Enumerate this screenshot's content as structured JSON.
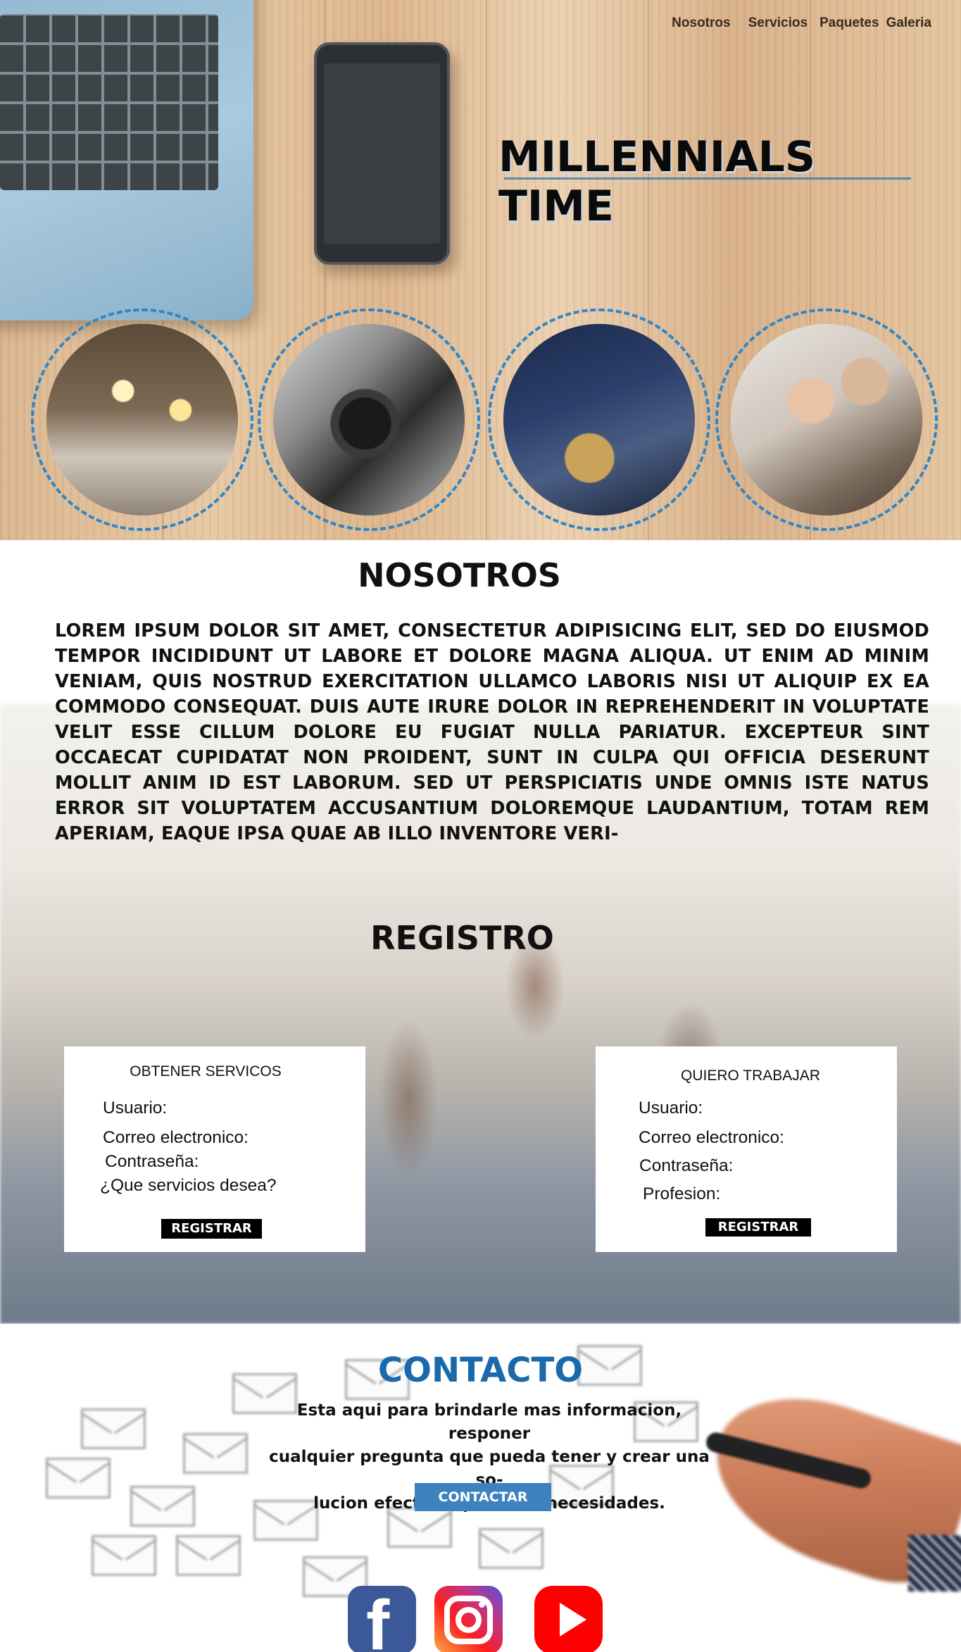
{
  "nav": {
    "items": [
      "Nosotros",
      "Servicios",
      "Paquetes",
      "Galeria"
    ]
  },
  "hero": {
    "title": "MILLENNIALS TIME"
  },
  "gallery": [
    {
      "icon": "event-lights-icon"
    },
    {
      "icon": "video-camera-icon"
    },
    {
      "icon": "dj-turntable-icon"
    },
    {
      "icon": "makeup-artist-icon"
    }
  ],
  "nosotros": {
    "title": "NOSOTROS",
    "text": "Lorem ipsum dolor sit amet, consectetur adipisicing elit, sed do eiusmod tempor incididunt ut labore et dolore magna aliqua. Ut enim ad minim veniam, quis nostrud exercitation ullamco laboris nisi ut aliquip ex ea commodo consequat. Duis aute irure dolor in reprehenderit in voluptate velit esse cillum dolore eu fugiat nulla pariatur. Excepteur sint occaecat cupidatat non proident, sunt in culpa qui officia deserunt mollit anim id est laborum. Sed ut perspiciatis unde omnis iste natus error sit voluptatem accusantium doloremque laudantium, totam rem aperiam, eaque ipsa quae ab illo inventore veri-"
  },
  "registro": {
    "title": "REGISTRO",
    "servicios": {
      "title": "OBTENER SERVICOS",
      "usuario": "Usuario:",
      "correo": "Correo electronico:",
      "password": "Contraseña:",
      "servicios": "¿Que servicios desea?",
      "button": "REGISTRAR"
    },
    "trabajar": {
      "title": "QUIERO TRABAJAR",
      "usuario": "Usuario:",
      "correo": "Correo electronico:",
      "password": "Contraseña:",
      "profesion": "Profesion:",
      "button": "REGISTRAR"
    }
  },
  "contacto": {
    "title": "CONTACTO",
    "line1": "Esta aqui para brindarle mas informacion, responer",
    "line2": "cualquier pregunta que pueda tener y crear una so-",
    "line3": "lucion efectivas para sus necesidades.",
    "button": "CONTACTAR"
  },
  "social": [
    {
      "icon": "facebook-icon",
      "color": "#3b5998"
    },
    {
      "icon": "instagram-icon",
      "color": "#c13584"
    },
    {
      "icon": "youtube-icon",
      "color": "#ff0000"
    }
  ],
  "colors": {
    "accent_blue": "#1a69aa",
    "dashed_ring": "#2f86c8",
    "button_dark": "#000000",
    "button_contact": "#3d82bf"
  }
}
